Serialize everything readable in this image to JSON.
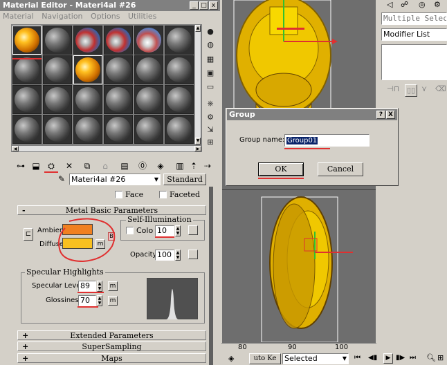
{
  "material_editor": {
    "title": "Material Editor - Materi4al #26",
    "menu": [
      "Material",
      "Navigation",
      "Options",
      "Utilities"
    ],
    "material_name": "Materi4al #26",
    "type_button": "Standard",
    "face_label": "Face",
    "faceted_label": "Faceted",
    "metal_rollout": "Metal Basic Parameters",
    "self_illum_group": "Self-Illumination",
    "ambient_label": "Ambient:",
    "diffuse_label": "Diffuse:",
    "colo_label": "Colo",
    "self_illum_value": "10",
    "opacity_label": "Opacity:",
    "opacity_value": "100",
    "specular_group": "Specular Highlights",
    "specular_level_label": "Specular Level:",
    "specular_level_value": "89",
    "glossiness_label": "Glossiness:",
    "glossiness_value": "70",
    "m_label": "m",
    "rollouts": [
      "Extended Parameters",
      "SuperSampling",
      "Maps"
    ],
    "colors": {
      "ambient": "#f08020",
      "diffuse": "#f8c020",
      "annotation": "#e03030"
    }
  },
  "group_dialog": {
    "title": "Group",
    "help": "?",
    "close": "X",
    "name_label": "Group name:",
    "name_value": "Group01",
    "ok": "OK",
    "cancel": "Cancel"
  },
  "command_panel": {
    "selection": "Multiple Selecte",
    "modifier_list": "Modifier List"
  },
  "viewport": {
    "ruler_ticks": [
      "80",
      "90",
      "100"
    ]
  },
  "status_bar": {
    "auto_key": "uto Ke",
    "selected": "Selected"
  }
}
